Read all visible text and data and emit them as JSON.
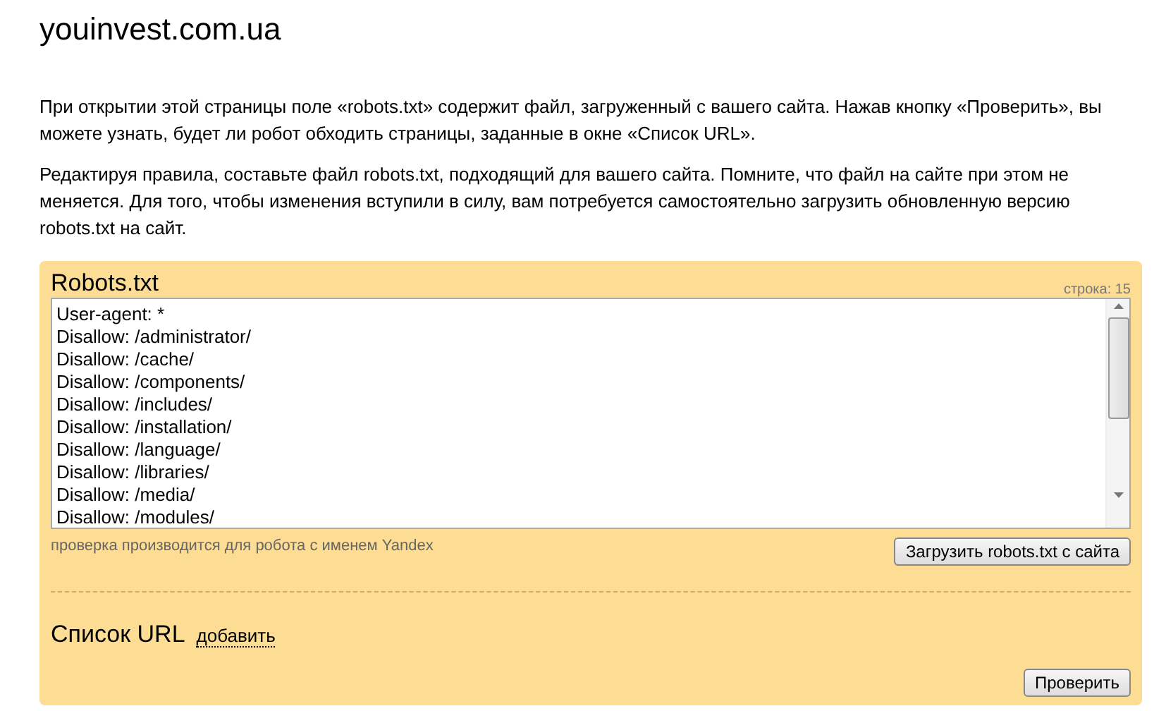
{
  "site_title": "youinvest.com.ua",
  "intro_paragraphs": [
    "При открытии этой страницы поле «robots.txt» содержит файл, загруженный с вашего сайта. Нажав кнопку «Проверить», вы можете узнать, будет ли робот обходить страницы, заданные в окне «Список URL».",
    "Редактируя правила, составьте файл robots.txt, подходящий для вашего сайта. Помните, что файл на сайте при этом не меняется. Для того, чтобы изменения вступили в силу, вам потребуется самостоятельно загрузить обновленную версию robots.txt на сайт."
  ],
  "robots_panel": {
    "title": "Robots.txt",
    "line_counter": "строка: 15",
    "lines": [
      "User-agent: *",
      "Disallow: /administrator/",
      "Disallow: /cache/",
      "Disallow: /components/",
      "Disallow: /includes/",
      "Disallow: /installation/",
      "Disallow: /language/",
      "Disallow: /libraries/",
      "Disallow: /media/",
      "Disallow: /modules/"
    ],
    "robot_note": "проверка производится для робота с именем Yandex",
    "load_button": "Загрузить robots.txt с сайта"
  },
  "url_list": {
    "title": "Список URL",
    "add_link": "добавить",
    "check_button": "Проверить"
  }
}
